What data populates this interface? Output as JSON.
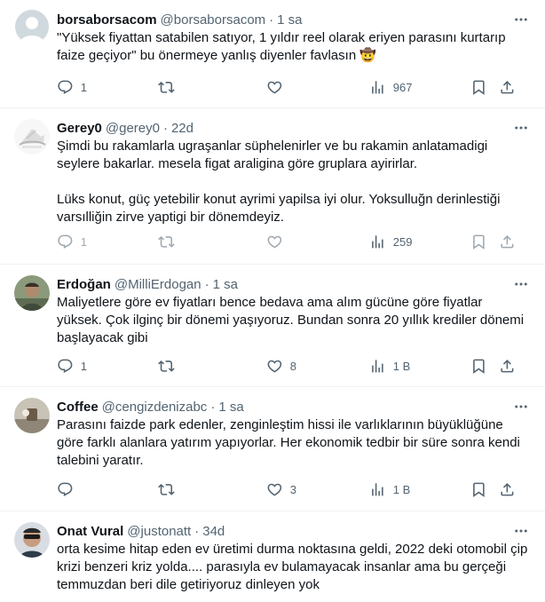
{
  "tweets": [
    {
      "name": "borsaborsacom",
      "handle": "@borsaborsacom",
      "time": "1 sa",
      "text": "\"Yüksek fiyattan satabilen satıyor, 1 yıldır reel olarak eriyen parasını kurtarıp faize geçiyor\" bu önermeye yanlış diyenler favlasın 🤠",
      "replies": "1",
      "retweets": "",
      "likes": "",
      "views": "967"
    },
    {
      "name": "Gerey0",
      "handle": "@gerey0",
      "time": "22d",
      "text": "Şimdi bu rakamlarla ugraşanlar süphelenirler ve bu rakamin anlatamadigi seylere bakarlar. mesela figat araligina göre gruplara ayirirlar.\n\nLüks konut, güç yetebilir konut ayrimi yapilsa iyi olur. Yoksulluğn derinlestiği varsılliğin zirve yaptigi bir dönemdeyiz.",
      "replies": "1",
      "retweets": "",
      "likes": "",
      "views": "259"
    },
    {
      "name": "Erdoğan",
      "handle": "@MilliErdogan",
      "time": "1 sa",
      "text": "Maliyetlere göre ev fiyatları bence bedava ama alım gücüne göre fiyatlar yüksek. Çok ilginç bir dönemi yaşıyoruz. Bundan sonra 20 yıllık krediler dönemi başlayacak gibi",
      "replies": "1",
      "retweets": "",
      "likes": "8",
      "views": "1 B"
    },
    {
      "name": "Coffee",
      "handle": "@cengizdenizabc",
      "time": "1 sa",
      "text": "Parasını faizde park edenler, zenginleştim hissi ile varlıklarının büyüklüğüne göre farklı alanlara yatırım yapıyorlar. Her ekonomik tedbir bir süre sonra kendi talebini yaratır.",
      "replies": "",
      "retweets": "",
      "likes": "3",
      "views": "1 B"
    },
    {
      "name": "Onat Vural",
      "handle": "@justonatt",
      "time": "34d",
      "text": "orta kesime hitap eden ev üretimi durma noktasına geldi, 2022 deki otomobil çip krizi benzeri kriz yolda.... parasıyla ev bulamayacak insanlar ama bu gerçeği temmuzdan beri dile getiriyoruz dinleyen yok",
      "replies": "",
      "retweets": "",
      "likes": "",
      "views": ""
    }
  ],
  "icons": {
    "reply": "reply-icon",
    "retweet": "retweet-icon",
    "like": "like-icon",
    "views": "views-icon",
    "bookmark": "bookmark-icon",
    "share": "share-icon",
    "more": "more-icon"
  },
  "colors": {
    "text": "#0f1419",
    "secondary": "#536471",
    "divider": "#eff3f4"
  }
}
